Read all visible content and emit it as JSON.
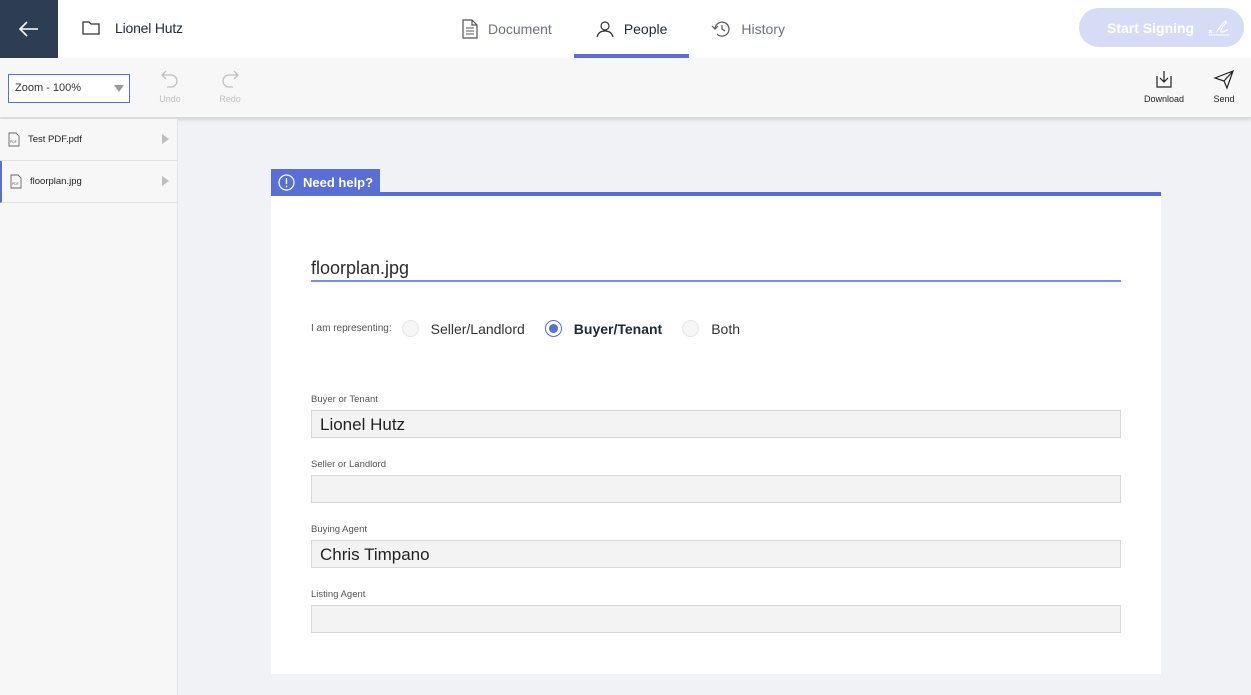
{
  "header": {
    "project_title": "Lionel Hutz",
    "tabs": [
      {
        "label": "Document",
        "icon": "document-icon"
      },
      {
        "label": "People",
        "icon": "person-icon",
        "active": true
      },
      {
        "label": "History",
        "icon": "history-icon"
      }
    ],
    "start_signing_label": "Start Signing"
  },
  "toolbar": {
    "zoom_value": "Zoom - 100%",
    "undo_label": "Undo",
    "redo_label": "Redo",
    "download_label": "Download",
    "send_label": "Send"
  },
  "sidebar": {
    "files": [
      {
        "name": "Test PDF.pdf"
      },
      {
        "name": "floorplan.jpg",
        "active": true
      }
    ]
  },
  "main": {
    "help_label": "Need help?",
    "document_name": "floorplan.jpg",
    "representing_label": "I am representing:",
    "options": [
      "Seller/Landlord",
      "Buyer/Tenant",
      "Both"
    ],
    "selected_option": "Buyer/Tenant",
    "fields": [
      {
        "label": "Buyer or Tenant",
        "value": "Lionel Hutz"
      },
      {
        "label": "Seller or Landlord",
        "value": ""
      },
      {
        "label": "Buying Agent",
        "value": "Chris Timpano"
      },
      {
        "label": "Listing Agent",
        "value": ""
      }
    ]
  },
  "colors": {
    "accent": "#5a6fd6",
    "dark_nav": "#2d3e54",
    "start_button": "#d6dcf6"
  }
}
